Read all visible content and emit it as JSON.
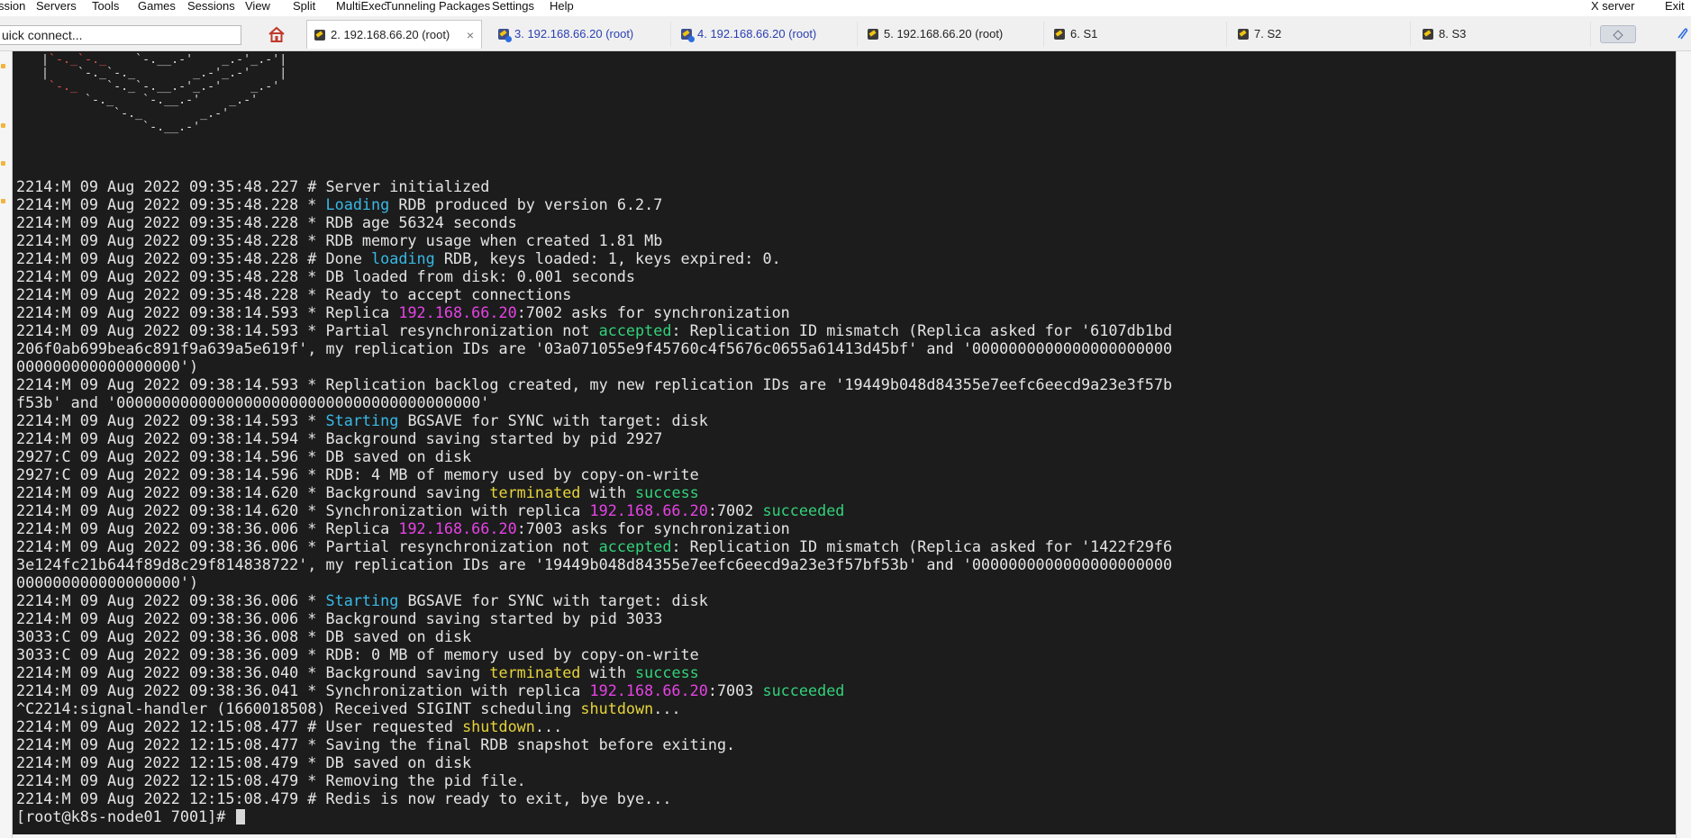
{
  "menubar": {
    "left": [
      "ssion",
      "Servers",
      "Tools",
      "Games",
      "Sessions",
      "View",
      "Split",
      "MultiExec",
      "Tunneling",
      "Packages",
      "Settings",
      "Help"
    ],
    "right": [
      "X server",
      "Exit"
    ]
  },
  "quick_connect": {
    "value": "uick connect..."
  },
  "tabs": [
    {
      "label": "2. 192.168.66.20 (root)",
      "active": true,
      "close": "×",
      "color": "#222222"
    },
    {
      "label": "3. 192.168.66.20 (root)",
      "active": false,
      "color": "#2a3fb2"
    },
    {
      "label": "4. 192.168.66.20 (root)",
      "active": false,
      "color": "#2a3fb2"
    },
    {
      "label": "5. 192.168.66.20 (root)",
      "active": false,
      "color": "#222222"
    },
    {
      "label": "6. S1",
      "active": false,
      "color": "#222222"
    },
    {
      "label": "7. S2",
      "active": false,
      "color": "#222222"
    },
    {
      "label": "8. S3",
      "active": false,
      "color": "#222222"
    }
  ],
  "icons": {
    "home": "home-icon",
    "tab": "terminal-tab-icon",
    "new_tab": "new-tab-icon",
    "extra": "attach-icon"
  },
  "colors": {
    "terminal_bg": "#1c1c1c",
    "terminal_fg": "#e4e4e4",
    "cyan": "#38b9e6",
    "magenta": "#e543e5",
    "green": "#33d17a",
    "yellow": "#e6d33b"
  },
  "terminal": {
    "logo": [
      [
        {
          "t": "   |"
        },
        {
          "t": "`-._`-._",
          "c": "r"
        },
        {
          "t": "    `-.__.-'    _.-'_.-'|"
        }
      ],
      [
        {
          "t": "   |    `-._`-._        _.-'_.-'    |"
        }
      ],
      [
        {
          "t": "    "
        },
        {
          "t": "`-._",
          "c": "r"
        },
        {
          "t": "    `-._`-.__.-'_.-'    _.-'"
        }
      ],
      [
        {
          "t": "         `-._    `-.__.-'    _.-'"
        }
      ],
      [
        {
          "t": "             `-._        _.-'"
        }
      ],
      [
        {
          "t": "                 `-.__.-'"
        }
      ]
    ],
    "lines": [
      [
        {
          "t": "2214:M 09 Aug 2022 09:35:48.227 # Server initialized"
        }
      ],
      [
        {
          "t": "2214:M 09 Aug 2022 09:35:48.228 * "
        },
        {
          "t": "Loading",
          "c": "cyan"
        },
        {
          "t": " RDB produced by version 6.2.7"
        }
      ],
      [
        {
          "t": "2214:M 09 Aug 2022 09:35:48.228 * RDB age 56324 seconds"
        }
      ],
      [
        {
          "t": "2214:M 09 Aug 2022 09:35:48.228 * RDB memory usage when created 1.81 Mb"
        }
      ],
      [
        {
          "t": "2214:M 09 Aug 2022 09:35:48.228 # Done "
        },
        {
          "t": "loading",
          "c": "cyan"
        },
        {
          "t": " RDB, keys loaded: 1, keys expired: 0."
        }
      ],
      [
        {
          "t": "2214:M 09 Aug 2022 09:35:48.228 * DB loaded from disk: 0.001 seconds"
        }
      ],
      [
        {
          "t": "2214:M 09 Aug 2022 09:35:48.228 * Ready to accept connections"
        }
      ],
      [
        {
          "t": "2214:M 09 Aug 2022 09:38:14.593 * Replica "
        },
        {
          "t": "192.168.66.20",
          "c": "mag"
        },
        {
          "t": ":7002 asks for synchronization"
        }
      ],
      [
        {
          "t": "2214:M 09 Aug 2022 09:38:14.593 * Partial resynchronization not "
        },
        {
          "t": "accepted",
          "c": "green"
        },
        {
          "t": ": Replication ID mismatch (Replica asked for '6107db1bd"
        }
      ],
      [
        {
          "t": "206f0ab699bea6c891f9a639a5e619f', my replication IDs are '03a071055e9f45760c4f5676c0655a61413d45bf' and '0000000000000000000000"
        }
      ],
      [
        {
          "t": "000000000000000000')"
        }
      ],
      [
        {
          "t": "2214:M 09 Aug 2022 09:38:14.593 * Replication backlog created, my new replication IDs are '19449b048d84355e7eefc6eecd9a23e3f57b"
        }
      ],
      [
        {
          "t": "f53b' and '0000000000000000000000000000000000000000'"
        }
      ],
      [
        {
          "t": "2214:M 09 Aug 2022 09:38:14.593 * "
        },
        {
          "t": "Starting",
          "c": "cyan"
        },
        {
          "t": " BGSAVE for SYNC with target: disk"
        }
      ],
      [
        {
          "t": "2214:M 09 Aug 2022 09:38:14.594 * Background saving started by pid 2927"
        }
      ],
      [
        {
          "t": "2927:C 09 Aug 2022 09:38:14.596 * DB saved on disk"
        }
      ],
      [
        {
          "t": "2927:C 09 Aug 2022 09:38:14.596 * RDB: 4 MB of memory used by copy-on-write"
        }
      ],
      [
        {
          "t": "2214:M 09 Aug 2022 09:38:14.620 * Background saving "
        },
        {
          "t": "terminated",
          "c": "yellow"
        },
        {
          "t": " with "
        },
        {
          "t": "success",
          "c": "green"
        }
      ],
      [
        {
          "t": "2214:M 09 Aug 2022 09:38:14.620 * Synchronization with replica "
        },
        {
          "t": "192.168.66.20",
          "c": "mag"
        },
        {
          "t": ":7002 "
        },
        {
          "t": "succeeded",
          "c": "green"
        }
      ],
      [
        {
          "t": "2214:M 09 Aug 2022 09:38:36.006 * Replica "
        },
        {
          "t": "192.168.66.20",
          "c": "mag"
        },
        {
          "t": ":7003 asks for synchronization"
        }
      ],
      [
        {
          "t": "2214:M 09 Aug 2022 09:38:36.006 * Partial resynchronization not "
        },
        {
          "t": "accepted",
          "c": "green"
        },
        {
          "t": ": Replication ID mismatch (Replica asked for '1422f29f6"
        }
      ],
      [
        {
          "t": "3e124fc21b644f89d8c29f814838722', my replication IDs are '19449b048d84355e7eefc6eecd9a23e3f57bf53b' and '0000000000000000000000"
        }
      ],
      [
        {
          "t": "000000000000000000')"
        }
      ],
      [
        {
          "t": "2214:M 09 Aug 2022 09:38:36.006 * "
        },
        {
          "t": "Starting",
          "c": "cyan"
        },
        {
          "t": " BGSAVE for SYNC with target: disk"
        }
      ],
      [
        {
          "t": "2214:M 09 Aug 2022 09:38:36.006 * Background saving started by pid 3033"
        }
      ],
      [
        {
          "t": "3033:C 09 Aug 2022 09:38:36.008 * DB saved on disk"
        }
      ],
      [
        {
          "t": "3033:C 09 Aug 2022 09:38:36.009 * RDB: 0 MB of memory used by copy-on-write"
        }
      ],
      [
        {
          "t": "2214:M 09 Aug 2022 09:38:36.040 * Background saving "
        },
        {
          "t": "terminated",
          "c": "yellow"
        },
        {
          "t": " with "
        },
        {
          "t": "success",
          "c": "green"
        }
      ],
      [
        {
          "t": "2214:M 09 Aug 2022 09:38:36.041 * Synchronization with replica "
        },
        {
          "t": "192.168.66.20",
          "c": "mag"
        },
        {
          "t": ":7003 "
        },
        {
          "t": "succeeded",
          "c": "green"
        }
      ],
      [
        {
          "t": "^C2214:signal-handler (1660018508) Received SIGINT scheduling "
        },
        {
          "t": "shutdown",
          "c": "yellow"
        },
        {
          "t": "..."
        }
      ],
      [
        {
          "t": "2214:M 09 Aug 2022 12:15:08.477 # User requested "
        },
        {
          "t": "shutdown",
          "c": "yellow"
        },
        {
          "t": "..."
        }
      ],
      [
        {
          "t": "2214:M 09 Aug 2022 12:15:08.477 * Saving the final RDB snapshot before exiting."
        }
      ],
      [
        {
          "t": "2214:M 09 Aug 2022 12:15:08.479 * DB saved on disk"
        }
      ],
      [
        {
          "t": "2214:M 09 Aug 2022 12:15:08.479 * Removing the pid file."
        }
      ],
      [
        {
          "t": "2214:M 09 Aug 2022 12:15:08.479 # Redis is now ready to exit, bye bye..."
        }
      ]
    ],
    "prompt": "[root@k8s-node01 7001]# "
  }
}
